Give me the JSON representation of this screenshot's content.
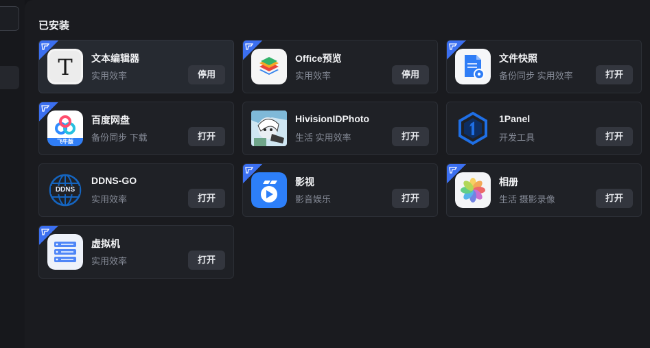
{
  "section": {
    "title": "已安装"
  },
  "apps": [
    {
      "name": "文本编辑器",
      "tags": "实用效率",
      "button": "停用",
      "ribbon": true,
      "icon": "text-editor-icon"
    },
    {
      "name": "Office预览",
      "tags": "实用效率",
      "button": "停用",
      "ribbon": true,
      "icon": "office-preview-icon"
    },
    {
      "name": "文件快照",
      "tags": "备份同步 实用效率",
      "button": "打开",
      "ribbon": true,
      "icon": "file-snapshot-icon"
    },
    {
      "name": "百度网盘",
      "tags": "备份同步 下载",
      "button": "打开",
      "ribbon": true,
      "icon": "baidu-netdisk-icon",
      "icon_label": "飞牛版"
    },
    {
      "name": "HivisionIDPhoto",
      "tags": "生活 实用效率",
      "button": "打开",
      "ribbon": false,
      "icon": "hivision-idphoto-icon"
    },
    {
      "name": "1Panel",
      "tags": "开发工具",
      "button": "打开",
      "ribbon": false,
      "icon": "1panel-icon"
    },
    {
      "name": "DDNS-GO",
      "tags": "实用效率",
      "button": "打开",
      "ribbon": false,
      "icon": "ddns-go-icon",
      "icon_label": "DDNS"
    },
    {
      "name": "影视",
      "tags": "影音娱乐",
      "button": "打开",
      "ribbon": true,
      "icon": "video-icon"
    },
    {
      "name": "相册",
      "tags": "生活 摄影录像",
      "button": "打开",
      "ribbon": true,
      "icon": "photos-icon"
    },
    {
      "name": "虚拟机",
      "tags": "实用效率",
      "button": "打开",
      "ribbon": true,
      "icon": "virtual-machine-icon"
    }
  ],
  "colors": {
    "accent": "#3b6ff0",
    "card_bg": "#1f2126",
    "button_bg": "#33363e"
  }
}
